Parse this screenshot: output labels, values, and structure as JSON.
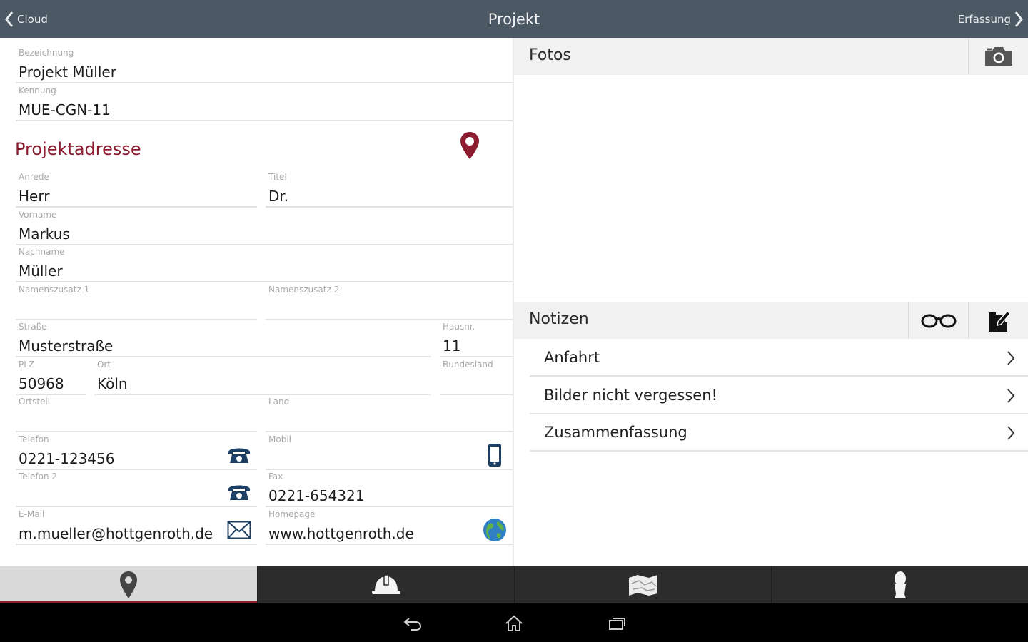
{
  "header": {
    "back_label": "Cloud",
    "title": "Projekt",
    "forward_label": "Erfassung"
  },
  "project": {
    "bezeichnung": {
      "label": "Bezeichnung",
      "value": "Projekt Müller"
    },
    "kennung": {
      "label": "Kennung",
      "value": "MUE-CGN-11"
    }
  },
  "address": {
    "section_title": "Projektadresse",
    "anrede": {
      "label": "Anrede",
      "value": "Herr"
    },
    "titel": {
      "label": "Titel",
      "value": "Dr."
    },
    "vorname": {
      "label": "Vorname",
      "value": "Markus"
    },
    "nachname": {
      "label": "Nachname",
      "value": "Müller"
    },
    "namenszusatz1": {
      "label": "Namenszusatz 1",
      "value": ""
    },
    "namenszusatz2": {
      "label": "Namenszusatz 2",
      "value": ""
    },
    "strasse": {
      "label": "Straße",
      "value": "Musterstraße"
    },
    "hausnr": {
      "label": "Hausnr.",
      "value": "11"
    },
    "plz": {
      "label": "PLZ",
      "value": "50968"
    },
    "ort": {
      "label": "Ort",
      "value": "Köln"
    },
    "bundesland": {
      "label": "Bundesland",
      "value": ""
    },
    "ortsteil": {
      "label": "Ortsteil",
      "value": ""
    },
    "land": {
      "label": "Land",
      "value": ""
    },
    "telefon": {
      "label": "Telefon",
      "value": "0221-123456"
    },
    "mobil": {
      "label": "Mobil",
      "value": ""
    },
    "telefon2": {
      "label": "Telefon 2",
      "value": ""
    },
    "fax": {
      "label": "Fax",
      "value": "0221-654321"
    },
    "email": {
      "label": "E-Mail",
      "value": "m.mueller@hottgenroth.de"
    },
    "homepage": {
      "label": "Homepage",
      "value": "www.hottgenroth.de"
    }
  },
  "photos": {
    "title": "Fotos"
  },
  "notes": {
    "title": "Notizen",
    "items": [
      {
        "label": "Anfahrt"
      },
      {
        "label": "Bilder nicht vergessen!"
      },
      {
        "label": "Zusammenfassung"
      }
    ]
  },
  "colors": {
    "accent": "#8b1b2e",
    "topbar": "#4b5864",
    "tabbar": "#2c2c2c"
  },
  "tabs": [
    "map-pin-icon",
    "helmet-icon",
    "map-icon",
    "person-icon"
  ]
}
